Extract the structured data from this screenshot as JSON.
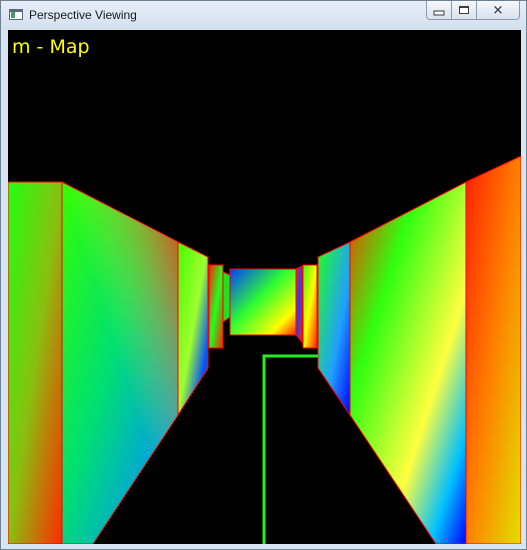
{
  "window": {
    "title": "Perspective Viewing",
    "icon": "app-window-icon",
    "buttons": {
      "minimize": "minimize-icon",
      "maximize": "maximize-icon",
      "close": "close-icon"
    }
  },
  "scene": {
    "hud_text": "m  -  Map",
    "hud_color": "#ffff00",
    "background": "#000000",
    "path_color": "#22ee22"
  }
}
